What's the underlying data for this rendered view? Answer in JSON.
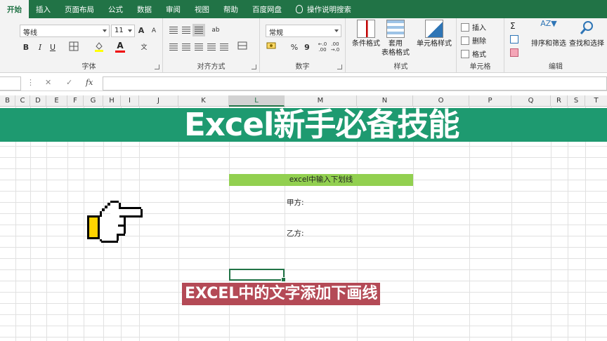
{
  "ribbon": {
    "tabs": [
      "开始",
      "插入",
      "页面布局",
      "公式",
      "数据",
      "审阅",
      "视图",
      "帮助",
      "百度网盘",
      "操作说明搜索"
    ],
    "active_tab": "开始",
    "font": {
      "name": "等线",
      "size": "11",
      "grow": "A",
      "shrink": "A",
      "bold": "B",
      "italic": "I",
      "underline": "U",
      "label": "字体"
    },
    "alignment": {
      "label": "对齐方式"
    },
    "number": {
      "format": "常规",
      "percent": "%",
      "comma": "9",
      "label": "数字"
    },
    "styles": {
      "conditional": "条件格式",
      "table_line1": "套用",
      "table_line2": "表格格式",
      "cell_styles": "单元格样式",
      "label": "样式"
    },
    "cells": {
      "insert": "插入",
      "delete": "删除",
      "format": "格式",
      "label": "单元格"
    },
    "editing": {
      "sigma": "Σ",
      "sort_filter": "排序和筛选",
      "find_select": "查找和选择",
      "label": "编辑"
    }
  },
  "formula_bar": {
    "fx": "fx",
    "cancel": "✕",
    "confirm": "✓",
    "value": ""
  },
  "columns": [
    "B",
    "C",
    "D",
    "E",
    "F",
    "G",
    "H",
    "I",
    "J",
    "K",
    "L",
    "M",
    "N",
    "O",
    "P",
    "Q",
    "R",
    "S",
    "T"
  ],
  "selected_column": "L",
  "banner_title": "Excel新手必备技能",
  "sheet": {
    "header_cell": "excel中输入下划线",
    "party_a": "甲方:",
    "party_b": "乙方:"
  },
  "caption": "EXCEL中的文字添加下画线",
  "colors": {
    "excel_green": "#217346",
    "banner": "#1e9a70",
    "cell_fill": "#92d050",
    "caption_bg": "#b44a56"
  }
}
